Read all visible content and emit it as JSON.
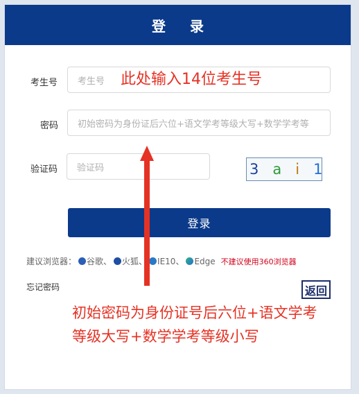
{
  "header": {
    "title": "登  录"
  },
  "form": {
    "exam_id_label": "考生号",
    "exam_id_placeholder": "考生号",
    "password_label": "密码",
    "password_placeholder": "初始密码为身份证后六位+语文学考等级大写+数学学考等",
    "captcha_label": "验证码",
    "captcha_placeholder": "验证码",
    "captcha_chars": [
      "3",
      "a",
      "i",
      "1"
    ],
    "login_button": "登录"
  },
  "browsers": {
    "prefix": "建议浏览器：",
    "items": [
      {
        "label": "谷歌、",
        "icon": "chrome-icon"
      },
      {
        "label": "火狐、",
        "icon": "firefox-icon"
      },
      {
        "label": "IE10、",
        "icon": "ie-icon"
      },
      {
        "label": "Edge",
        "icon": "edge-icon"
      }
    ],
    "warning": "不建议使用360浏览器"
  },
  "links": {
    "forgot": "忘记密码",
    "back": "返回"
  },
  "annotations": {
    "note1": "此处输入14位考生号",
    "note2_line1": "初始密码为身份证号后六位+语文学考",
    "note2_line2": "等级大写+数学学考等级小写"
  },
  "colors": {
    "header_bg": "#0b3a8a",
    "annotation_red": "#e53224",
    "warning_red": "#d0021b"
  }
}
